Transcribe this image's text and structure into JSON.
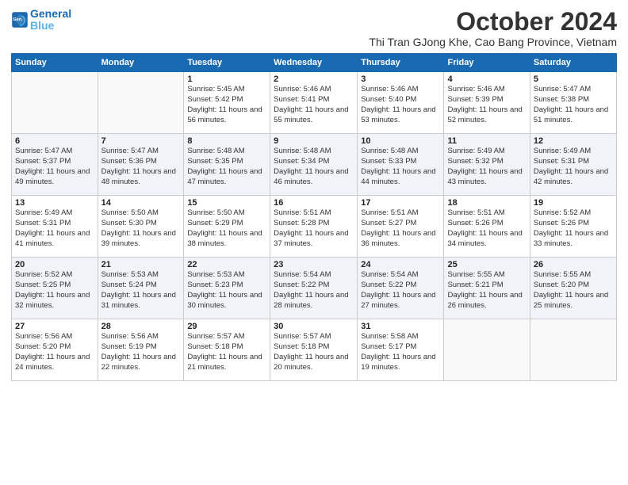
{
  "logo": {
    "line1": "General",
    "line2": "Blue"
  },
  "title": "October 2024",
  "location": "Thi Tran GJong Khe, Cao Bang Province, Vietnam",
  "days_of_week": [
    "Sunday",
    "Monday",
    "Tuesday",
    "Wednesday",
    "Thursday",
    "Friday",
    "Saturday"
  ],
  "weeks": [
    [
      {
        "num": "",
        "sunrise": "",
        "sunset": "",
        "daylight": ""
      },
      {
        "num": "",
        "sunrise": "",
        "sunset": "",
        "daylight": ""
      },
      {
        "num": "1",
        "sunrise": "Sunrise: 5:45 AM",
        "sunset": "Sunset: 5:42 PM",
        "daylight": "Daylight: 11 hours and 56 minutes."
      },
      {
        "num": "2",
        "sunrise": "Sunrise: 5:46 AM",
        "sunset": "Sunset: 5:41 PM",
        "daylight": "Daylight: 11 hours and 55 minutes."
      },
      {
        "num": "3",
        "sunrise": "Sunrise: 5:46 AM",
        "sunset": "Sunset: 5:40 PM",
        "daylight": "Daylight: 11 hours and 53 minutes."
      },
      {
        "num": "4",
        "sunrise": "Sunrise: 5:46 AM",
        "sunset": "Sunset: 5:39 PM",
        "daylight": "Daylight: 11 hours and 52 minutes."
      },
      {
        "num": "5",
        "sunrise": "Sunrise: 5:47 AM",
        "sunset": "Sunset: 5:38 PM",
        "daylight": "Daylight: 11 hours and 51 minutes."
      }
    ],
    [
      {
        "num": "6",
        "sunrise": "Sunrise: 5:47 AM",
        "sunset": "Sunset: 5:37 PM",
        "daylight": "Daylight: 11 hours and 49 minutes."
      },
      {
        "num": "7",
        "sunrise": "Sunrise: 5:47 AM",
        "sunset": "Sunset: 5:36 PM",
        "daylight": "Daylight: 11 hours and 48 minutes."
      },
      {
        "num": "8",
        "sunrise": "Sunrise: 5:48 AM",
        "sunset": "Sunset: 5:35 PM",
        "daylight": "Daylight: 11 hours and 47 minutes."
      },
      {
        "num": "9",
        "sunrise": "Sunrise: 5:48 AM",
        "sunset": "Sunset: 5:34 PM",
        "daylight": "Daylight: 11 hours and 46 minutes."
      },
      {
        "num": "10",
        "sunrise": "Sunrise: 5:48 AM",
        "sunset": "Sunset: 5:33 PM",
        "daylight": "Daylight: 11 hours and 44 minutes."
      },
      {
        "num": "11",
        "sunrise": "Sunrise: 5:49 AM",
        "sunset": "Sunset: 5:32 PM",
        "daylight": "Daylight: 11 hours and 43 minutes."
      },
      {
        "num": "12",
        "sunrise": "Sunrise: 5:49 AM",
        "sunset": "Sunset: 5:31 PM",
        "daylight": "Daylight: 11 hours and 42 minutes."
      }
    ],
    [
      {
        "num": "13",
        "sunrise": "Sunrise: 5:49 AM",
        "sunset": "Sunset: 5:31 PM",
        "daylight": "Daylight: 11 hours and 41 minutes."
      },
      {
        "num": "14",
        "sunrise": "Sunrise: 5:50 AM",
        "sunset": "Sunset: 5:30 PM",
        "daylight": "Daylight: 11 hours and 39 minutes."
      },
      {
        "num": "15",
        "sunrise": "Sunrise: 5:50 AM",
        "sunset": "Sunset: 5:29 PM",
        "daylight": "Daylight: 11 hours and 38 minutes."
      },
      {
        "num": "16",
        "sunrise": "Sunrise: 5:51 AM",
        "sunset": "Sunset: 5:28 PM",
        "daylight": "Daylight: 11 hours and 37 minutes."
      },
      {
        "num": "17",
        "sunrise": "Sunrise: 5:51 AM",
        "sunset": "Sunset: 5:27 PM",
        "daylight": "Daylight: 11 hours and 36 minutes."
      },
      {
        "num": "18",
        "sunrise": "Sunrise: 5:51 AM",
        "sunset": "Sunset: 5:26 PM",
        "daylight": "Daylight: 11 hours and 34 minutes."
      },
      {
        "num": "19",
        "sunrise": "Sunrise: 5:52 AM",
        "sunset": "Sunset: 5:26 PM",
        "daylight": "Daylight: 11 hours and 33 minutes."
      }
    ],
    [
      {
        "num": "20",
        "sunrise": "Sunrise: 5:52 AM",
        "sunset": "Sunset: 5:25 PM",
        "daylight": "Daylight: 11 hours and 32 minutes."
      },
      {
        "num": "21",
        "sunrise": "Sunrise: 5:53 AM",
        "sunset": "Sunset: 5:24 PM",
        "daylight": "Daylight: 11 hours and 31 minutes."
      },
      {
        "num": "22",
        "sunrise": "Sunrise: 5:53 AM",
        "sunset": "Sunset: 5:23 PM",
        "daylight": "Daylight: 11 hours and 30 minutes."
      },
      {
        "num": "23",
        "sunrise": "Sunrise: 5:54 AM",
        "sunset": "Sunset: 5:22 PM",
        "daylight": "Daylight: 11 hours and 28 minutes."
      },
      {
        "num": "24",
        "sunrise": "Sunrise: 5:54 AM",
        "sunset": "Sunset: 5:22 PM",
        "daylight": "Daylight: 11 hours and 27 minutes."
      },
      {
        "num": "25",
        "sunrise": "Sunrise: 5:55 AM",
        "sunset": "Sunset: 5:21 PM",
        "daylight": "Daylight: 11 hours and 26 minutes."
      },
      {
        "num": "26",
        "sunrise": "Sunrise: 5:55 AM",
        "sunset": "Sunset: 5:20 PM",
        "daylight": "Daylight: 11 hours and 25 minutes."
      }
    ],
    [
      {
        "num": "27",
        "sunrise": "Sunrise: 5:56 AM",
        "sunset": "Sunset: 5:20 PM",
        "daylight": "Daylight: 11 hours and 24 minutes."
      },
      {
        "num": "28",
        "sunrise": "Sunrise: 5:56 AM",
        "sunset": "Sunset: 5:19 PM",
        "daylight": "Daylight: 11 hours and 22 minutes."
      },
      {
        "num": "29",
        "sunrise": "Sunrise: 5:57 AM",
        "sunset": "Sunset: 5:18 PM",
        "daylight": "Daylight: 11 hours and 21 minutes."
      },
      {
        "num": "30",
        "sunrise": "Sunrise: 5:57 AM",
        "sunset": "Sunset: 5:18 PM",
        "daylight": "Daylight: 11 hours and 20 minutes."
      },
      {
        "num": "31",
        "sunrise": "Sunrise: 5:58 AM",
        "sunset": "Sunset: 5:17 PM",
        "daylight": "Daylight: 11 hours and 19 minutes."
      },
      {
        "num": "",
        "sunrise": "",
        "sunset": "",
        "daylight": ""
      },
      {
        "num": "",
        "sunrise": "",
        "sunset": "",
        "daylight": ""
      }
    ]
  ]
}
